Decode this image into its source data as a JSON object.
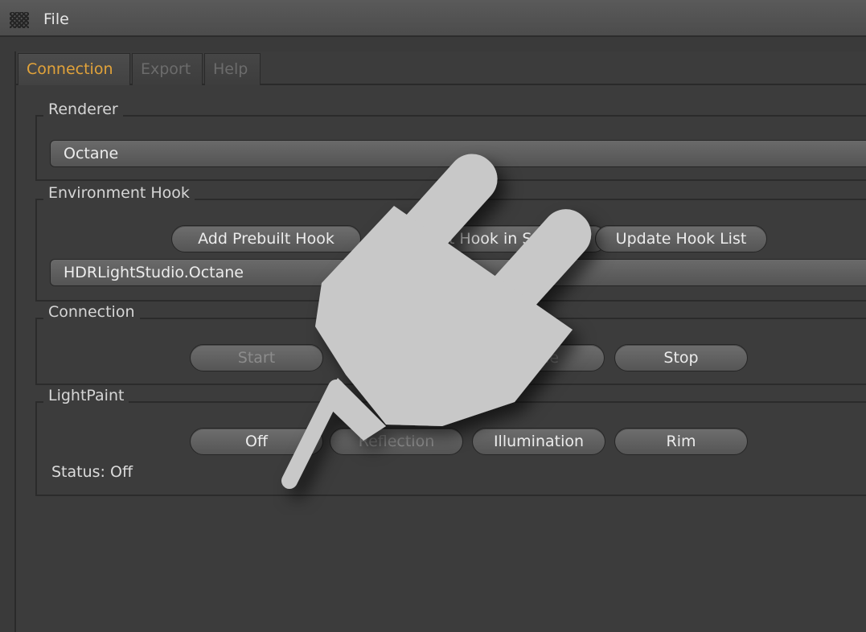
{
  "menubar": {
    "file_label": "File"
  },
  "tabs": [
    {
      "label": "Connection",
      "active": true
    },
    {
      "label": "Export",
      "active": false
    },
    {
      "label": "Help",
      "active": false
    }
  ],
  "renderer": {
    "title": "Renderer",
    "selected": "Octane"
  },
  "environment_hook": {
    "title": "Environment Hook",
    "buttons": [
      "Add Prebuilt Hook",
      "Select Hook in Scene",
      "Update Hook List"
    ],
    "selected": "HDRLightStudio.Octane"
  },
  "connection": {
    "title": "Connection",
    "buttons": [
      "Start",
      "Mode",
      "Stop"
    ]
  },
  "lightpaint": {
    "title": "LightPaint",
    "buttons": [
      "Off",
      "Reflection",
      "Illumination",
      "Rim"
    ],
    "status": "Status: Off"
  },
  "overlay": {
    "icon": "plug-icon"
  },
  "colors": {
    "accent": "#e2a33a",
    "background": "#3c3c3c",
    "plug": "#c8c8c8"
  }
}
